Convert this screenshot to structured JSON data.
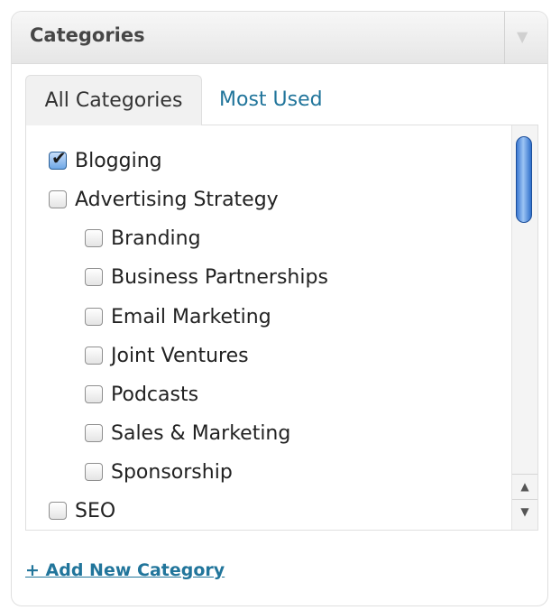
{
  "header": {
    "title": "Categories",
    "toggle_icon": "triangle-down-icon"
  },
  "tabs": [
    {
      "label": "All Categories",
      "active": true
    },
    {
      "label": "Most Used",
      "active": false
    }
  ],
  "categories": [
    {
      "label": "Blogging",
      "checked": true,
      "level": 0
    },
    {
      "label": "Advertising Strategy",
      "checked": false,
      "level": 0
    },
    {
      "label": "Branding",
      "checked": false,
      "level": 1
    },
    {
      "label": "Business Partnerships",
      "checked": false,
      "level": 1
    },
    {
      "label": "Email Marketing",
      "checked": false,
      "level": 1
    },
    {
      "label": "Joint Ventures",
      "checked": false,
      "level": 1
    },
    {
      "label": "Podcasts",
      "checked": false,
      "level": 1
    },
    {
      "label": "Sales & Marketing",
      "checked": false,
      "level": 1
    },
    {
      "label": "Sponsorship",
      "checked": false,
      "level": 1
    },
    {
      "label": "SEO",
      "checked": false,
      "level": 0
    }
  ],
  "add_link": {
    "label": "+ Add New Category"
  },
  "colors": {
    "link": "#21759b",
    "checkbox_checked": "#6fa7e6",
    "scroll_thumb": "#3b78d2"
  }
}
